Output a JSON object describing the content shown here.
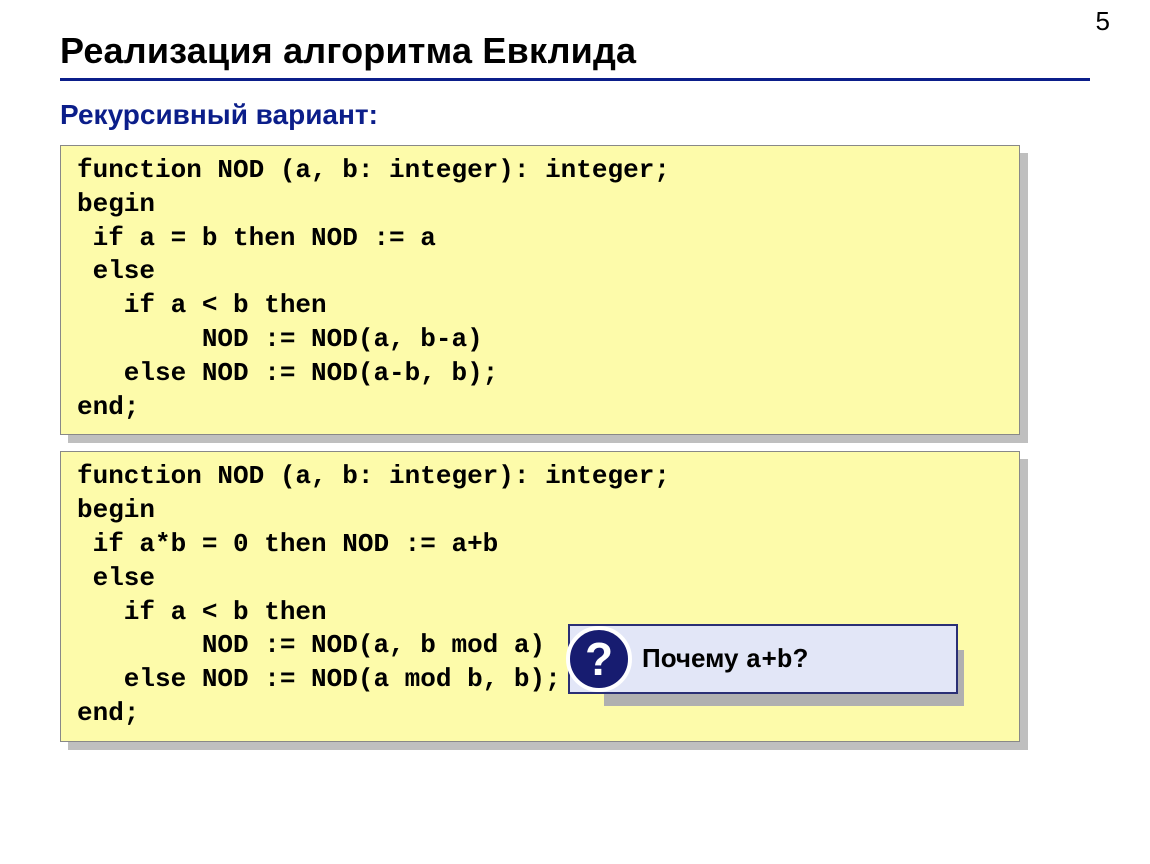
{
  "page_number": "5",
  "title": "Реализация алгоритма Евклида",
  "subtitle": "Рекурсивный вариант:",
  "code_block_1": "function NOD (a, b: integer): integer;\nbegin\n if a = b then NOD := a\n else\n   if a < b then\n        NOD := NOD(a, b-a)\n   else NOD := NOD(a-b, b);\nend;",
  "code_block_2": "function NOD (a, b: integer): integer;\nbegin\n if a*b = 0 then NOD := a+b\n else\n   if a < b then\n        NOD := NOD(a, b mod a)\n   else NOD := NOD(a mod b, b);\nend;",
  "callout": {
    "badge": "?",
    "text_prefix": "Почему ",
    "text_code": "a+b",
    "text_suffix": "?"
  }
}
